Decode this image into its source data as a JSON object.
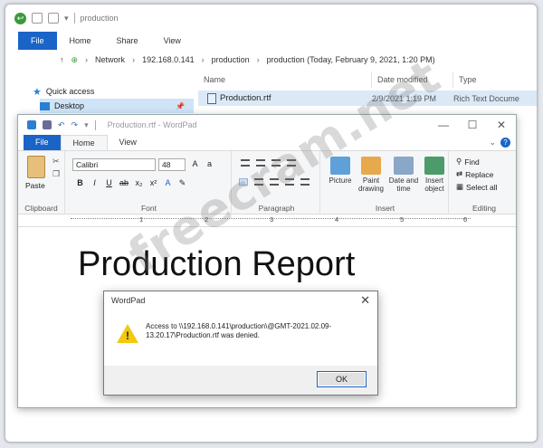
{
  "explorer": {
    "title": "production",
    "ribbon_tabs": [
      "File",
      "Home",
      "Share",
      "View"
    ],
    "address": [
      "Network",
      "192.168.0.141",
      "production",
      "production (Today, February 9, 2021, 1:20 PM)"
    ],
    "nav": [
      {
        "label": "Quick access"
      },
      {
        "label": "Desktop"
      }
    ],
    "columns": [
      "Name",
      "Date modified",
      "Type"
    ],
    "file": {
      "name": "Production.rtf",
      "date": "2/9/2021 1:19 PM",
      "type": "Rich Text Docume"
    }
  },
  "wordpad": {
    "title": "Production.rtf - WordPad",
    "window_controls": [
      "—",
      "☐",
      "✕"
    ],
    "tabs": [
      "File",
      "Home",
      "View"
    ],
    "font_name": "Calibri",
    "font_size": "48",
    "groups": [
      "Clipboard",
      "Font",
      "Paragraph",
      "Insert",
      "Editing"
    ],
    "paste_label": "Paste",
    "insert_buttons": [
      "Picture",
      "Paint drawing",
      "Date and time",
      "Insert object"
    ],
    "editing": [
      "Find",
      "Replace",
      "Select all"
    ],
    "ruler_numbers": [
      "1",
      "2",
      "3",
      "4",
      "5",
      "6"
    ],
    "document_heading": "Production Report"
  },
  "dialog": {
    "title": "WordPad",
    "message": "Access to \\\\192.168.0.141\\production\\@GMT-2021.02.09-13.20.17\\Production.rtf was denied.",
    "ok_label": "OK"
  },
  "watermark": "freecram.net",
  "colors": {
    "accent": "#1a64c8",
    "warning": "#f2c811"
  }
}
